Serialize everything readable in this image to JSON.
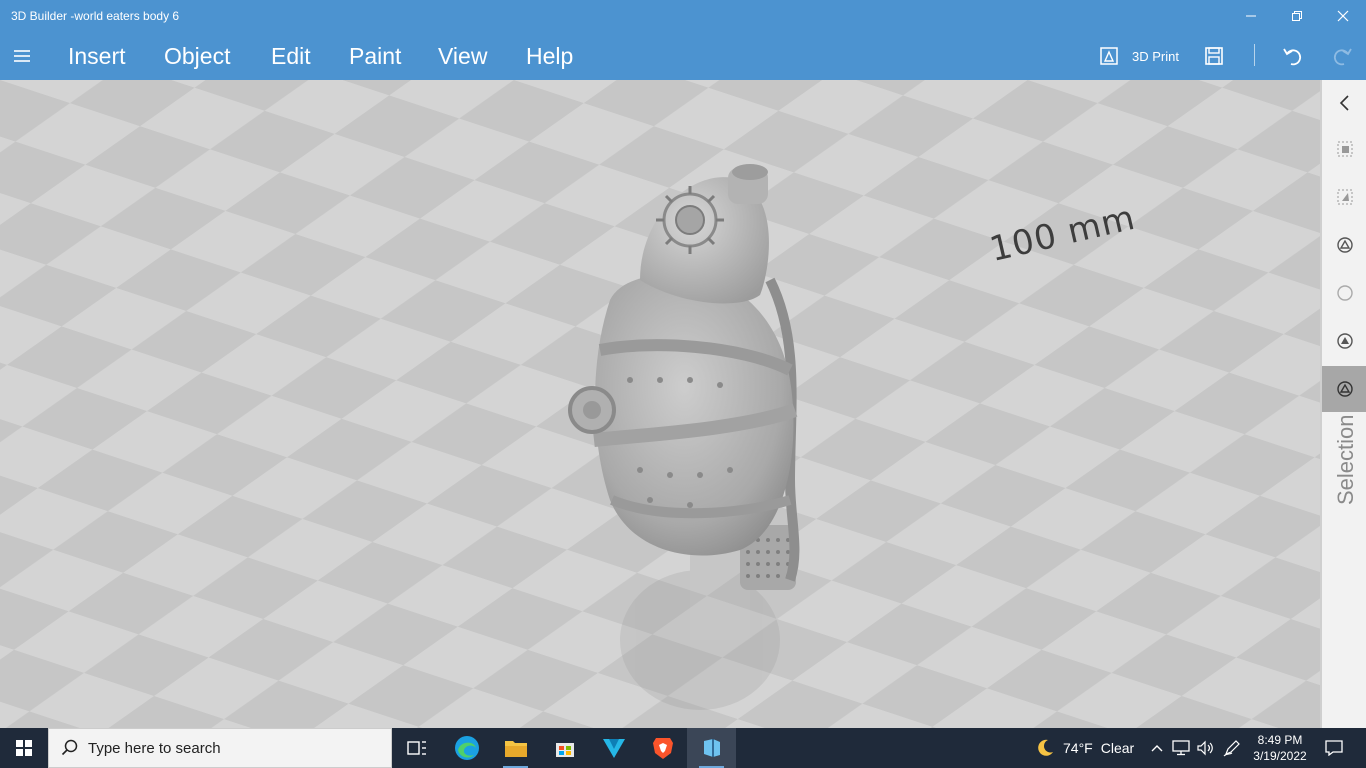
{
  "window": {
    "title": "3D Builder -world eaters body 6"
  },
  "menu": {
    "items": [
      "Insert",
      "Object",
      "Edit",
      "Paint",
      "View",
      "Help"
    ],
    "print_label": "3D Print"
  },
  "viewport": {
    "scale_label": "100 mm"
  },
  "right_toolbar": {
    "panel_label": "Selection"
  },
  "taskbar": {
    "search_placeholder": "Type here to search",
    "weather": {
      "temp": "74°F",
      "condition": "Clear"
    },
    "clock": {
      "time": "8:49 PM",
      "date": "3/19/2022"
    }
  },
  "colors": {
    "accent": "#4c93d0",
    "taskbar": "#1f2a3a",
    "floor": "#d2d2d2"
  }
}
